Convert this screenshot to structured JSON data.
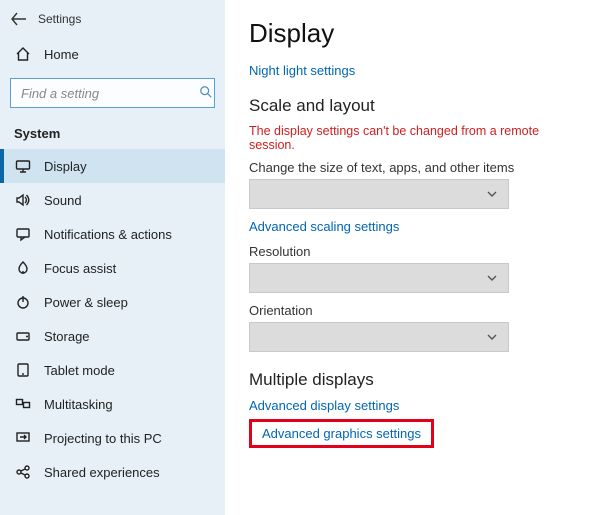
{
  "window_title": "Settings",
  "home_label": "Home",
  "search_placeholder": "Find a setting",
  "category_label": "System",
  "sidebar": {
    "items": [
      {
        "label": "Display",
        "selected": true
      },
      {
        "label": "Sound"
      },
      {
        "label": "Notifications & actions"
      },
      {
        "label": "Focus assist"
      },
      {
        "label": "Power & sleep"
      },
      {
        "label": "Storage"
      },
      {
        "label": "Tablet mode"
      },
      {
        "label": "Multitasking"
      },
      {
        "label": "Projecting to this PC"
      },
      {
        "label": "Shared experiences"
      }
    ]
  },
  "main": {
    "heading": "Display",
    "night_link": "Night light settings",
    "scale_heading": "Scale and layout",
    "warning": "The display settings can't be changed from a remote session.",
    "scale_label": "Change the size of text, apps, and other items",
    "adv_scaling_link": "Advanced scaling settings",
    "resolution_label": "Resolution",
    "orientation_label": "Orientation",
    "multi_heading": "Multiple displays",
    "adv_display_link": "Advanced display settings",
    "adv_graphics_link": "Advanced graphics settings"
  }
}
